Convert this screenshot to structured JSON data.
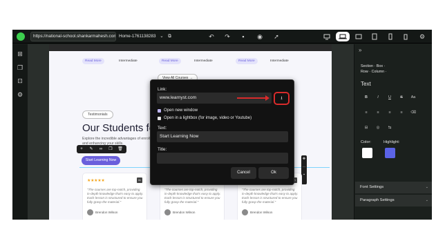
{
  "topbar": {
    "url": "https://national-school.shankarmahesh.com/",
    "page_name": "Home-1761138283"
  },
  "page": {
    "cards_top": [
      {
        "read_more": "Read More",
        "level": "Intermediate"
      },
      {
        "read_more": "Read More",
        "level": "Intermediate"
      },
      {
        "read_more": "Read More",
        "level": "Intermediate"
      }
    ],
    "view_all": "View All Courses →",
    "testimonials_badge": "Testimonials",
    "headline": "Our Students fe",
    "subtext": "Explore the incredible advantages of enrolling in our courses and enhancing your skills.",
    "start_button": "Start Learning Now",
    "testimonial_cards": [
      {
        "stars": "★★★★★",
        "quote": "\"The courses are top-notch, providing in-depth knowledge that's easy to apply. Each lesson is structured to ensure you fully grasp the material.\"",
        "author": "Brendon Wilson"
      },
      {
        "stars": "★★★★★",
        "quote": "\"The courses are top-notch, providing in-depth knowledge that's easy to apply. Each lesson is structured to ensure you fully grasp the material.\"",
        "author": "Brendon Wilson"
      },
      {
        "stars": "★★★★★",
        "quote": "\"The courses are top-notch, providing in-depth knowledge that's easy to apply. Each lesson is structured to ensure you fully grasp the material.\"",
        "author": "Brendon Wilson"
      }
    ]
  },
  "link_modal": {
    "link_label": "Link:",
    "link_value": "www.learnyst.com",
    "open_new_window_label": "Open new window",
    "open_new_window_checked": true,
    "lightbox_label": "Open in a lightbox (for image, video or Youtube)",
    "lightbox_checked": false,
    "text_label": "Text:",
    "text_value": "Start Learning Now",
    "title_label": "Title:",
    "title_value": "",
    "cancel_label": "Cancel",
    "ok_label": "Ok"
  },
  "right_panel": {
    "breadcrumb_line1": "Section · Box ·",
    "breadcrumb_line2": "Row · Column ·",
    "heading": "Text",
    "format_buttons": [
      "B",
      "I",
      "U",
      "S",
      "Aa",
      "≡",
      "≡",
      "≡",
      "≡",
      "⌫",
      "⊟",
      "◎",
      "⇆"
    ],
    "color_label": "Color:",
    "highlight_label": "Highlight:",
    "color_value": "#ffffff",
    "highlight_value": "#5b63e6",
    "font_settings_label": "Font Settings",
    "paragraph_settings_label": "Paragraph Settings"
  },
  "colors": {
    "accent": "#6a5fdc",
    "annotation_red": "#d92b2b",
    "editor_bg": "#1b201d"
  }
}
